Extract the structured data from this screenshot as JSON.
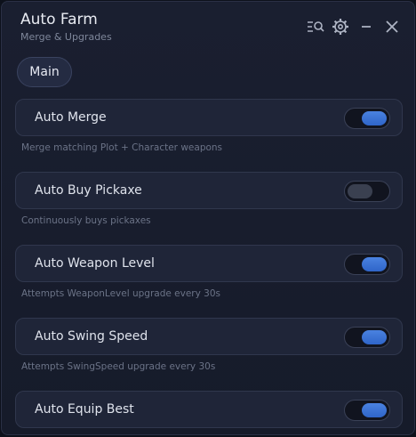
{
  "window": {
    "title": "Auto Farm",
    "subtitle": "Merge & Upgrades"
  },
  "titlebar_icons": [
    "search-list-icon",
    "gear-icon",
    "minimize-icon",
    "close-icon"
  ],
  "tabs": [
    {
      "label": "Main",
      "active": true
    }
  ],
  "toggles": [
    {
      "label": "Auto Merge",
      "description": "Merge matching Plot + Character weapons",
      "enabled": true
    },
    {
      "label": "Auto Buy Pickaxe",
      "description": "Continuously buys pickaxes",
      "enabled": false
    },
    {
      "label": "Auto Weapon Level",
      "description": "Attempts WeaponLevel upgrade every 30s",
      "enabled": true
    },
    {
      "label": "Auto Swing Speed",
      "description": "Attempts SwingSpeed upgrade every 30s",
      "enabled": true
    },
    {
      "label": "Auto Equip Best",
      "description": "",
      "enabled": true
    }
  ],
  "colors": {
    "accent": "#3b74d8",
    "background": "#161b2a",
    "card": "#1f2538"
  }
}
